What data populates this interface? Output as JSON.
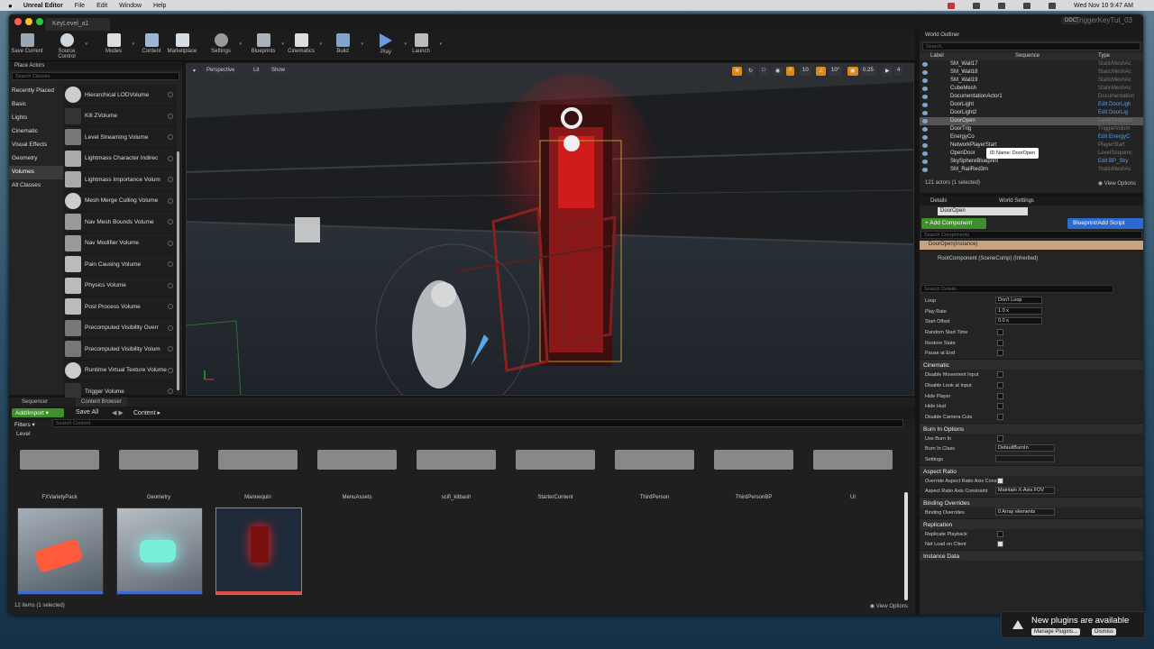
{
  "mac": {
    "app": "Unreal Editor",
    "menus": [
      "File",
      "Edit",
      "Window",
      "Help"
    ],
    "clock": "Wed Nov 10  9:47 AM"
  },
  "window": {
    "tab": "KeyLevel_a1",
    "project": "TriggerKeyTut_03",
    "ddc": "DDC"
  },
  "toolbar": [
    {
      "label": "Save Current",
      "color": "#9aa7b5"
    },
    {
      "label": "Source Control",
      "color": "#cfd6dd"
    },
    {
      "label": "Modes",
      "color": "#ddd"
    },
    {
      "label": "Content",
      "color": "#9ab5d8"
    },
    {
      "label": "Marketplace",
      "color": "#d6dde5"
    },
    {
      "label": "Settings",
      "color": "#999"
    },
    {
      "label": "Blueprints",
      "color": "#aab2bd"
    },
    {
      "label": "Cinematics",
      "color": "#ddd"
    },
    {
      "label": "Build",
      "color": "#7fa4d1"
    },
    {
      "label": "Play",
      "color": "#6a9be0"
    },
    {
      "label": "Launch",
      "color": "#bbb"
    }
  ],
  "place": {
    "tab": "Place Actors",
    "search": "Search Classes",
    "categories": [
      "Recently Placed",
      "Basic",
      "Lights",
      "Cinematic",
      "Visual Effects",
      "Geometry",
      "Volumes",
      "All Classes"
    ],
    "selected_category": "Volumes",
    "items": [
      "Hierarchical LODVolume",
      "Kill ZVolume",
      "Level Streaming Volume",
      "Lightmass Character Indirec",
      "Lightmass Importance Volum",
      "Mesh Merge Culling Volume",
      "Nav Mesh Bounds Volume",
      "Nav Modifier Volume",
      "Pain Causing Volume",
      "Physics Volume",
      "Post Process Volume",
      "Precomputed Visibility Overr",
      "Precomputed Visibility Volum",
      "Runtime Virtual Texture Volume",
      "Trigger Volume"
    ]
  },
  "viewport": {
    "perspective": "Perspective",
    "lit": "Lit",
    "show": "Show",
    "grid": "10",
    "angle": "10°",
    "scale": "0.25",
    "cam": "4"
  },
  "outliner": {
    "tab": "World Outliner",
    "search": "Search...",
    "col_label": "Label",
    "col_seq": "Sequence",
    "col_type": "Type",
    "rows": [
      {
        "name": "SM_Wall17",
        "type": "StaticMeshAc",
        "link": false
      },
      {
        "name": "SM_Wall18",
        "type": "StaticMeshAc",
        "link": false
      },
      {
        "name": "SM_Wall19",
        "type": "StaticMeshAc",
        "link": false
      },
      {
        "name": "CubeMesh",
        "type": "StaticMeshAc",
        "link": false
      },
      {
        "name": "DocumentationActor1",
        "type": "Documentation",
        "link": false
      },
      {
        "name": "DoorLight",
        "type": "Edit DoorLigh",
        "link": true
      },
      {
        "name": "DoorLight2",
        "type": "Edit DoorLig",
        "link": true
      },
      {
        "name": "DoorOpen",
        "type": "LevelSequenc",
        "link": false
      },
      {
        "name": "DoorTrig",
        "type": "TriggerVolum",
        "link": false
      },
      {
        "name": "EnergyCo",
        "type": "Edit EnergyC",
        "link": true
      },
      {
        "name": "NetworkPlayerStart",
        "type": "PlayerStart",
        "link": false
      },
      {
        "name": "OpenDoor",
        "type": "LevelSequenc",
        "link": false
      },
      {
        "name": "SkySphereBlueprint",
        "type": "Edit BP_Sky",
        "link": true
      },
      {
        "name": "SM_RailRed3m",
        "type": "StaticMeshAc",
        "link": false
      }
    ],
    "tooltip": "ID Name: DoorOpen",
    "count": "121 actors (1 selected)",
    "view_options": "View Options"
  },
  "details": {
    "tab": "Details",
    "tab2": "World Settings",
    "name": "DoorOpen",
    "add_component": "+ Add Component",
    "blueprint": "Blueprint/Add Script",
    "search_components": "Search Components",
    "instance": "DoorOpen(Instance)",
    "root": "RootComponent (SceneComp) (Inherited)",
    "search_details": "Search Details",
    "playback": [
      {
        "label": "Loop",
        "kind": "select",
        "value": "Don't Loop"
      },
      {
        "label": "Play Rate",
        "kind": "field",
        "value": "1.0 x"
      },
      {
        "label": "Start Offset",
        "kind": "field",
        "value": "0.0 s"
      },
      {
        "label": "Random Start Time",
        "kind": "check",
        "value": false
      },
      {
        "label": "Restore State",
        "kind": "check",
        "value": false
      },
      {
        "label": "Pause at End",
        "kind": "check",
        "value": false
      }
    ],
    "sections": [
      {
        "title": "Cinematic",
        "rows": [
          {
            "label": "Disable Movement Input",
            "value": false
          },
          {
            "label": "Disable Look at Input",
            "value": false
          },
          {
            "label": "Hide Player",
            "value": false
          },
          {
            "label": "Hide Hud",
            "value": false
          },
          {
            "label": "Disable Camera Cuts",
            "value": false
          }
        ]
      },
      {
        "title": "Burn In Options",
        "rows": [
          {
            "label": "Use Burn In",
            "value": false
          },
          {
            "label": "Burn In Class",
            "value": null,
            "text": "DefaultBurnIn"
          },
          {
            "label": "Settings",
            "value": null,
            "text": ""
          }
        ]
      },
      {
        "title": "Aspect Ratio",
        "rows": [
          {
            "label": "Override Aspect Ratio Axis Const",
            "value": true
          },
          {
            "label": "Aspect Ratio Axis Constraint",
            "value": null,
            "text": "Maintain X-Axis FOV"
          }
        ]
      },
      {
        "title": "Binding Overrides",
        "rows": [
          {
            "label": "Binding Overrides",
            "value": null,
            "text": "0 Array elements"
          }
        ]
      },
      {
        "title": "Replication",
        "rows": [
          {
            "label": "Replicate Playback",
            "value": false
          },
          {
            "label": "Net Load on Client",
            "value": true
          }
        ]
      },
      {
        "title": "Instance Data",
        "rows": []
      }
    ]
  },
  "bottom": {
    "tab1": "Sequencer",
    "tab2": "Content Browser",
    "add": "Add/Import",
    "save": "Save All",
    "path": "Content",
    "filters": "Filters",
    "search": "Search Content",
    "crumb": "Level",
    "folders": [
      "FXVarietyPack",
      "Geometry",
      "Mannequin",
      "MenuAssets",
      "scifi_kitbash",
      "StarterContent",
      "ThirdPerson",
      "ThirdPersonBP",
      "UI"
    ],
    "status": "12 items (1 selected)",
    "view_options": "View Options"
  },
  "notification": {
    "title": "New plugins are available",
    "manage": "Manage Plugins...",
    "dismiss": "Dismiss"
  }
}
